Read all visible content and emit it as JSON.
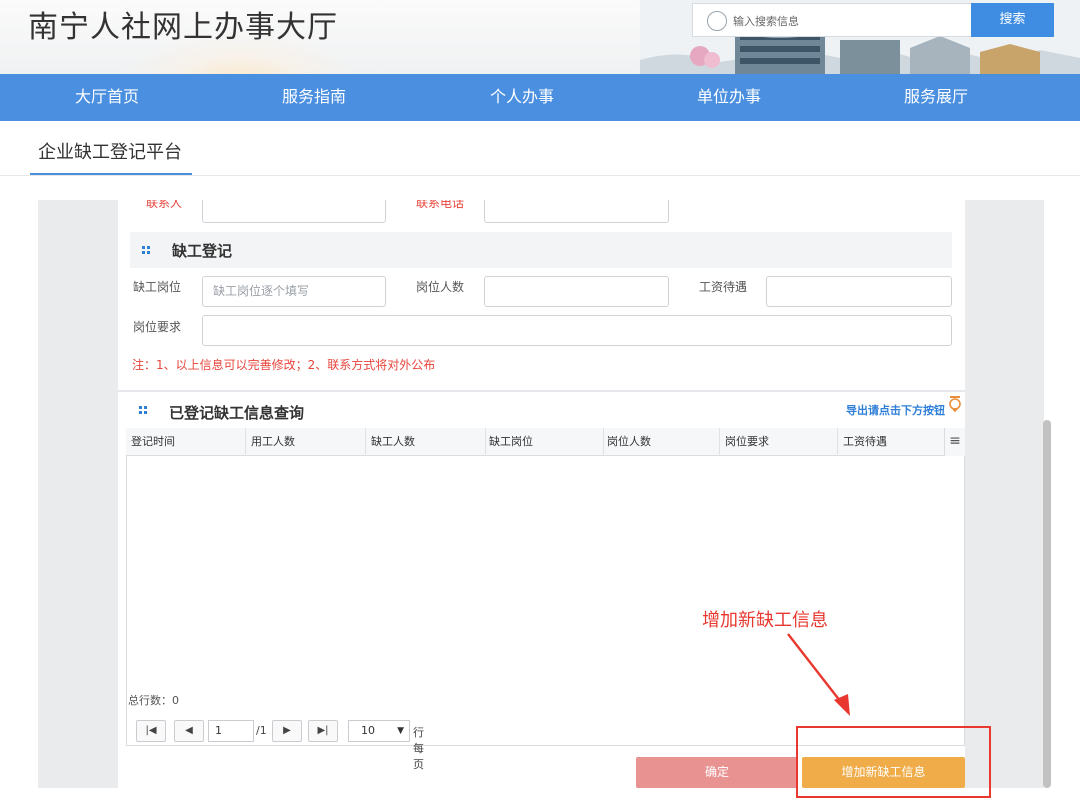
{
  "header": {
    "site_title": "南宁人社网上办事大厅",
    "search_placeholder": "输入搜索信息",
    "search_button": "搜索"
  },
  "nav": {
    "items": [
      "大厅首页",
      "服务指南",
      "个人办事",
      "单位办事",
      "服务展厅"
    ]
  },
  "tab": {
    "active_label": "企业缺工登记平台"
  },
  "contact_row": {
    "contact_label": "联系人",
    "phone_label": "联系电话"
  },
  "shortage_section": {
    "title": "缺工登记",
    "position_label": "缺工岗位",
    "position_placeholder": "缺工岗位逐个填写",
    "count_label": "岗位人数",
    "salary_label": "工资待遇",
    "requirement_label": "岗位要求",
    "note": "注：1、以上信息可以完善修改；2、联系方式将对外公布"
  },
  "registered_section": {
    "title": "已登记缺工信息查询",
    "export_hint": "导出请点击下方按钮",
    "columns": [
      "登记时间",
      "用工人数",
      "缺工人数",
      "缺工岗位",
      "岗位人数",
      "岗位要求",
      "工资待遇"
    ],
    "column_toggle_icon": "≡",
    "total_rows": "总行数：0",
    "pager": {
      "current_page": "1",
      "total_pages": "/1",
      "page_size": "10",
      "per_page_label": "行每页"
    }
  },
  "actions": {
    "confirm_label": "确定",
    "add_label": "增加新缺工信息"
  },
  "annotation": {
    "callout_text": "增加新缺工信息",
    "color": "#e8382f"
  },
  "colors": {
    "nav_blue": "#4a8fe0",
    "confirm_pink": "#e99292",
    "add_orange": "#efac48",
    "note_red": "#e8453c"
  }
}
